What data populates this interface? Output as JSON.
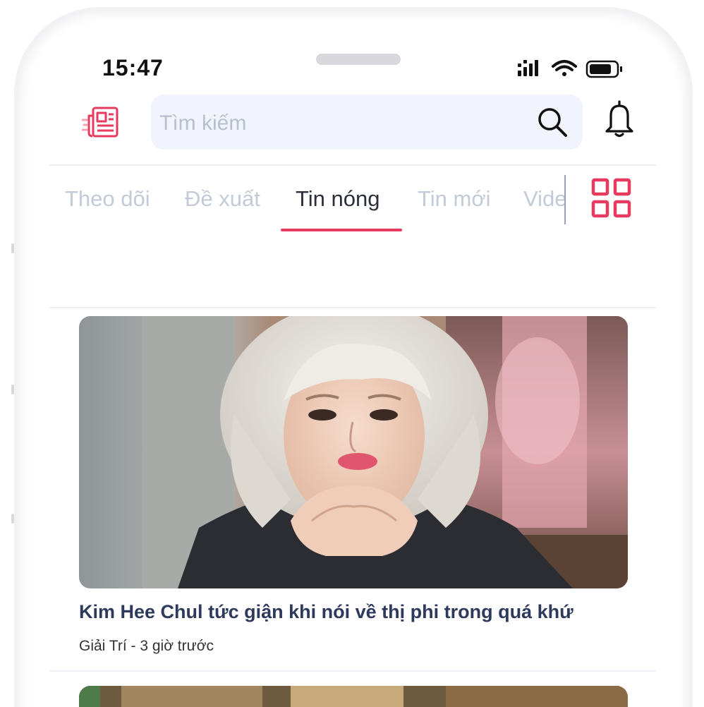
{
  "status_bar": {
    "time": "15:47",
    "icons": [
      "signal-icon",
      "wifi-icon",
      "battery-icon"
    ]
  },
  "header": {
    "logo_icon": "newspaper-icon",
    "search": {
      "placeholder": "Tìm kiếm",
      "value": ""
    },
    "notification_icon": "bell-icon"
  },
  "tabs": {
    "items": [
      {
        "label": "Theo dõi",
        "active": false
      },
      {
        "label": "Đề xuất",
        "active": false
      },
      {
        "label": "Tin nóng",
        "active": true
      },
      {
        "label": "Tin mới",
        "active": false
      },
      {
        "label": "Video",
        "active": false
      }
    ],
    "menu_icon": "grid-icon"
  },
  "articles": [
    {
      "title": "Kim Hee Chul tức giận khi nói về thị phi trong quá khứ",
      "category": "Giải Trí",
      "time_ago": "3 giờ trước",
      "meta": "Giải Trí - 3 giờ trước"
    }
  ],
  "colors": {
    "accent": "#e83a5f",
    "tab_inactive": "#c3cad8",
    "tab_active": "#2a2f3a",
    "title": "#2e3a5c",
    "search_bg": "#f1f4fa"
  }
}
